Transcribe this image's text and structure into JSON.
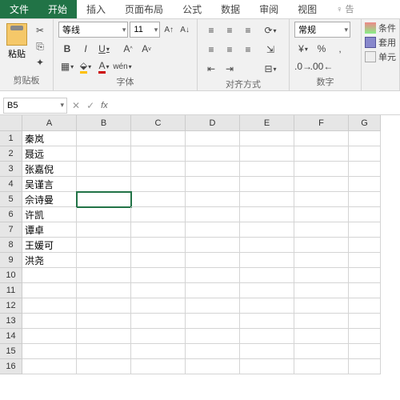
{
  "tabs": {
    "file": "文件",
    "home": "开始",
    "insert": "插入",
    "layout": "页面布局",
    "formula": "公式",
    "data": "数据",
    "review": "审阅",
    "view": "视图",
    "tell": "告"
  },
  "clipboard": {
    "paste": "粘贴",
    "label": "剪贴板"
  },
  "font": {
    "name": "等线",
    "size": "11",
    "bold": "B",
    "italic": "I",
    "underline": "U",
    "wen": "wén",
    "label": "字体"
  },
  "align": {
    "label": "对齐方式"
  },
  "number": {
    "format": "常规",
    "percent": "%",
    "comma": ",",
    "label": "数字"
  },
  "styles": {
    "cond": "条件",
    "table": "套用",
    "cell": "单元"
  },
  "nameBox": "B5",
  "fx": "fx",
  "cols": [
    "A",
    "B",
    "C",
    "D",
    "E",
    "F",
    "G"
  ],
  "rows": [
    "1",
    "2",
    "3",
    "4",
    "5",
    "6",
    "7",
    "8",
    "9",
    "10",
    "11",
    "12",
    "13",
    "14",
    "15",
    "16"
  ],
  "cellsA": [
    "秦岚",
    "聂远",
    "张嘉倪",
    "吴谨言",
    "佘诗曼",
    "许凯",
    "谭卓",
    "王媛可",
    "洪尧",
    "",
    "",
    "",
    "",
    "",
    "",
    ""
  ],
  "selected": {
    "row": 5,
    "col": "B"
  }
}
